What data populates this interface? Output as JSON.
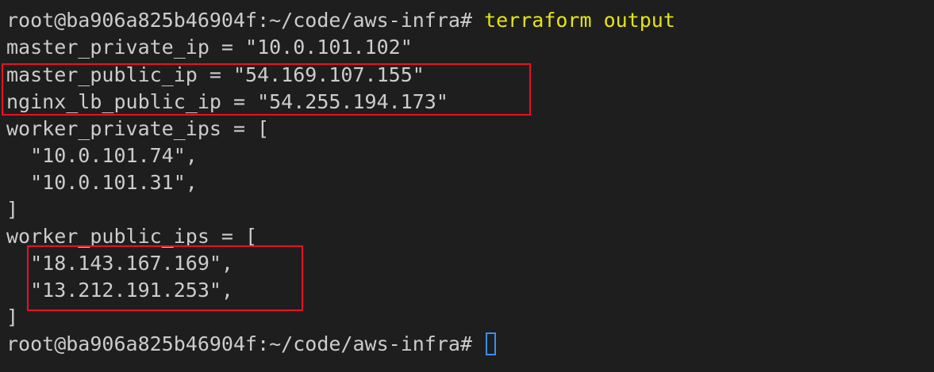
{
  "terminal": {
    "prompt": "root@ba906a825b46904f:~/code/aws-infra#",
    "command": "terraform output",
    "lines": [
      "master_private_ip = \"10.0.101.102\"",
      "master_public_ip = \"54.169.107.155\"",
      "nginx_lb_public_ip = \"54.255.194.173\"",
      "worker_private_ips = [",
      "  \"10.0.101.74\",",
      "  \"10.0.101.31\",",
      "]",
      "worker_public_ips = [",
      "  \"18.143.167.169\",",
      "  \"13.212.191.253\",",
      "]"
    ],
    "final_prompt": "root@ba906a825b46904f:~/code/aws-infra#"
  },
  "colors": {
    "background": "#1e1e1e",
    "text": "#cccccc",
    "command": "#e5e510",
    "highlight_box": "#e81123",
    "cursor": "#3b8eea"
  }
}
